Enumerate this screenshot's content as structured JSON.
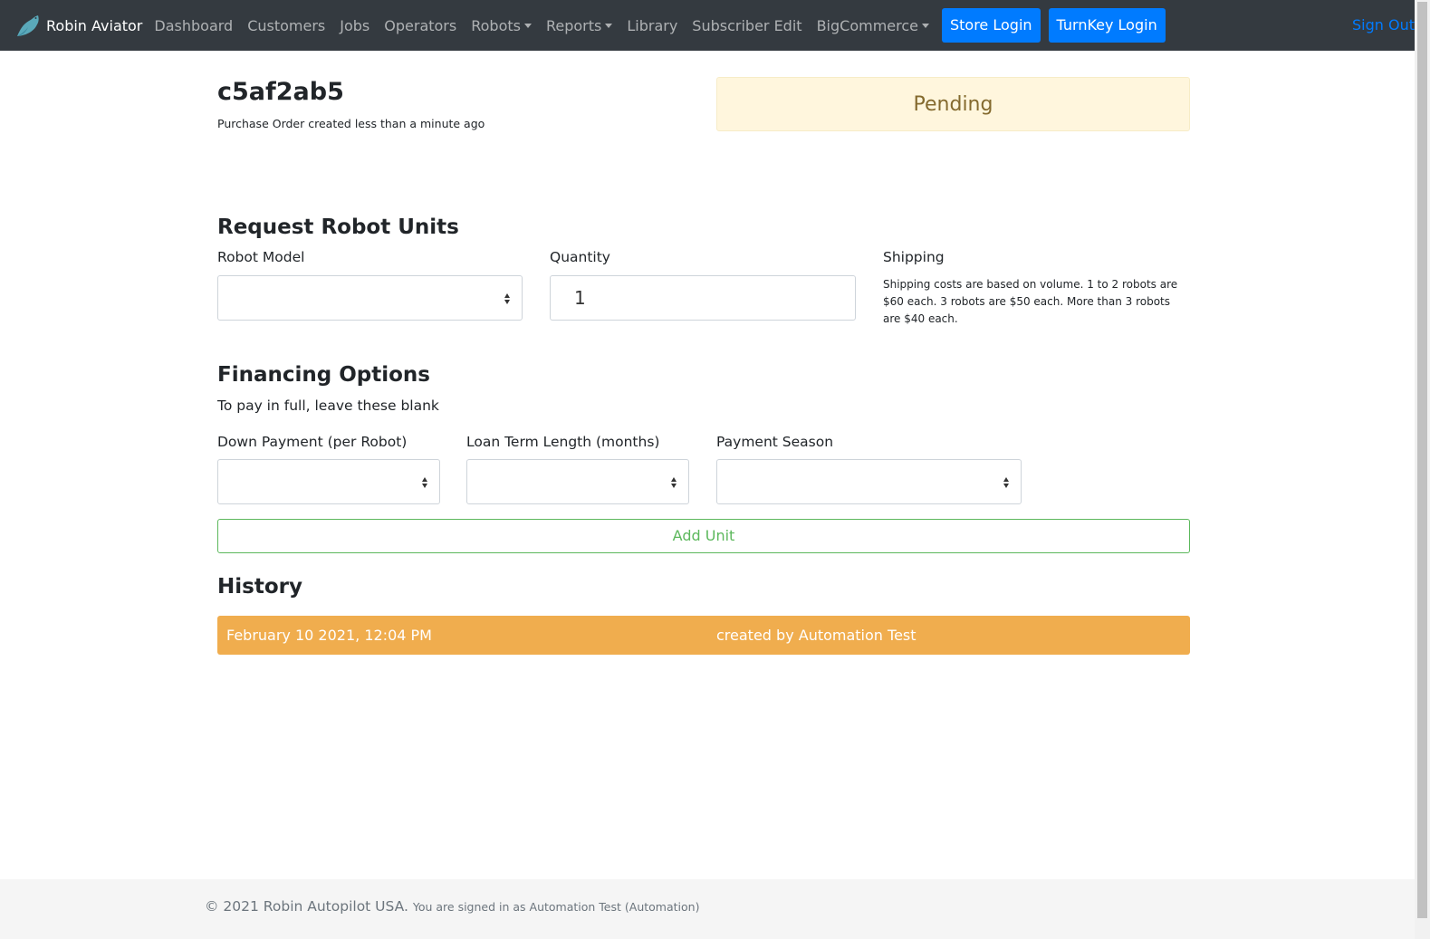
{
  "navbar": {
    "brand": "Robin Aviator",
    "items": [
      {
        "label": "Dashboard",
        "dropdown": false
      },
      {
        "label": "Customers",
        "dropdown": false
      },
      {
        "label": "Jobs",
        "dropdown": false
      },
      {
        "label": "Operators",
        "dropdown": false
      },
      {
        "label": "Robots",
        "dropdown": true
      },
      {
        "label": "Reports",
        "dropdown": true
      },
      {
        "label": "Library",
        "dropdown": false
      },
      {
        "label": "Subscriber Edit",
        "dropdown": false
      },
      {
        "label": "BigCommerce",
        "dropdown": true
      }
    ],
    "store_login": "Store Login",
    "turnkey_login": "TurnKey Login",
    "sign_out": "Sign Out"
  },
  "order": {
    "id": "c5af2ab5",
    "subtitle": "Purchase Order created less than a minute ago",
    "status": "Pending"
  },
  "request_units": {
    "heading": "Request Robot Units",
    "robot_model_label": "Robot Model",
    "robot_model_value": "",
    "quantity_label": "Quantity",
    "quantity_value": "1",
    "shipping_label": "Shipping",
    "shipping_desc": "Shipping costs are based on volume. 1 to 2 robots are $60 each. 3 robots are $50 each. More than 3 robots are $40 each."
  },
  "financing": {
    "heading": "Financing Options",
    "note": "To pay in full, leave these blank",
    "down_payment_label": "Down Payment (per Robot)",
    "loan_term_label": "Loan Term Length (months)",
    "payment_season_label": "Payment Season",
    "add_unit": "Add Unit"
  },
  "history": {
    "heading": "History",
    "entries": [
      {
        "date": "February 10 2021, 12:04 PM",
        "event": "created by Automation Test"
      }
    ]
  },
  "footer": {
    "copyright": "© 2021 Robin Autopilot USA.",
    "signed_in": "You are signed in as Automation Test (Automation)"
  },
  "colors": {
    "navbar_bg": "#343a40",
    "primary": "#007bff",
    "pending_bg": "#fff6dd",
    "history_row": "#f0ad4e",
    "add_unit": "#5cb85c"
  }
}
